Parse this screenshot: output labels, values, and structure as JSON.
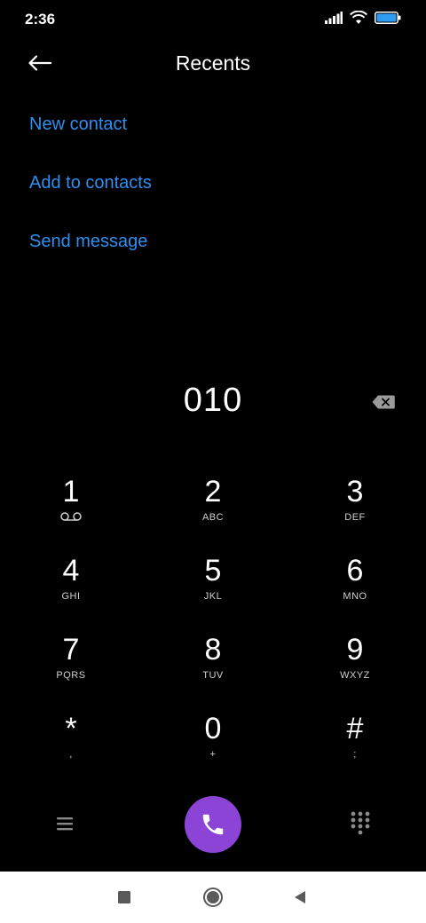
{
  "status_bar": {
    "time": "2:36",
    "icons": [
      "signal-icon",
      "wifi-icon",
      "battery-icon"
    ]
  },
  "header": {
    "title": "Recents",
    "back_icon": "arrow-left-icon"
  },
  "actions": [
    {
      "label": "New contact"
    },
    {
      "label": "Add to contacts"
    },
    {
      "label": "Send message"
    }
  ],
  "dialer": {
    "number": "010",
    "backspace_icon": "backspace-icon"
  },
  "keypad": [
    {
      "digit": "1",
      "letters": ""
    },
    {
      "digit": "2",
      "letters": "ABC"
    },
    {
      "digit": "3",
      "letters": "DEF"
    },
    {
      "digit": "4",
      "letters": "GHI"
    },
    {
      "digit": "5",
      "letters": "JKL"
    },
    {
      "digit": "6",
      "letters": "MNO"
    },
    {
      "digit": "7",
      "letters": "PQRS"
    },
    {
      "digit": "8",
      "letters": "TUV"
    },
    {
      "digit": "9",
      "letters": "WXYZ"
    },
    {
      "digit": "*",
      "letters": ","
    },
    {
      "digit": "0",
      "letters": "+"
    },
    {
      "digit": "#",
      "letters": ";"
    }
  ],
  "bottom_bar": {
    "menu_icon": "menu-icon",
    "call_icon": "phone-icon",
    "dialpad_icon": "dialpad-icon",
    "call_color": "#8b44d6"
  },
  "nav_bar": {
    "icons": [
      "recent-apps-icon",
      "home-icon",
      "back-icon"
    ]
  },
  "colors": {
    "accent": "#2e8ff0",
    "background": "#000000"
  }
}
